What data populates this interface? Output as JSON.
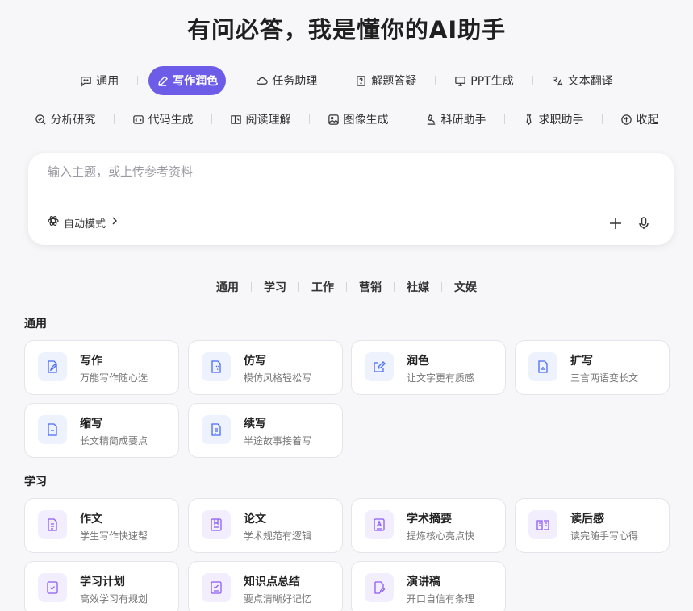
{
  "page_title": "有问必答，我是懂你的AI助手",
  "tabs_row1": [
    {
      "label": "通用",
      "icon": "chat-bubble-icon",
      "active": false
    },
    {
      "label": "写作润色",
      "icon": "pen-icon",
      "active": true
    },
    {
      "label": "任务助理",
      "icon": "cloud-icon",
      "active": false
    },
    {
      "label": "解题答疑",
      "icon": "question-doc-icon",
      "active": false
    },
    {
      "label": "PPT生成",
      "icon": "presentation-icon",
      "active": false
    },
    {
      "label": "文本翻译",
      "icon": "translate-icon",
      "active": false
    }
  ],
  "tabs_row2": [
    {
      "label": "分析研究",
      "icon": "analysis-icon"
    },
    {
      "label": "代码生成",
      "icon": "code-icon"
    },
    {
      "label": "阅读理解",
      "icon": "book-icon"
    },
    {
      "label": "图像生成",
      "icon": "image-icon"
    },
    {
      "label": "科研助手",
      "icon": "microscope-icon"
    },
    {
      "label": "求职助手",
      "icon": "tie-icon"
    },
    {
      "label": "收起",
      "icon": "collapse-up-icon"
    }
  ],
  "input": {
    "placeholder": "输入主题，或上传参考资料",
    "value": ""
  },
  "mode": {
    "label": "自动模式"
  },
  "categories": [
    "通用",
    "学习",
    "工作",
    "营销",
    "社媒",
    "文娱"
  ],
  "sections": [
    {
      "title": "通用",
      "color": "blue",
      "cards": [
        {
          "title": "写作",
          "desc": "万能写作随心选",
          "icon": "write-doc-icon"
        },
        {
          "title": "仿写",
          "desc": "模仿风格轻松写",
          "icon": "copy-doc-icon"
        },
        {
          "title": "润色",
          "desc": "让文字更有质感",
          "icon": "edit-square-icon"
        },
        {
          "title": "扩写",
          "desc": "三言两语变长文",
          "icon": "expand-doc-icon"
        },
        {
          "title": "缩写",
          "desc": "长文精简成要点",
          "icon": "shrink-doc-icon"
        },
        {
          "title": "续写",
          "desc": "半途故事接着写",
          "icon": "continue-doc-icon"
        }
      ]
    },
    {
      "title": "学习",
      "color": "purple",
      "cards": [
        {
          "title": "作文",
          "desc": "学生写作快速帮",
          "icon": "essay-doc-icon"
        },
        {
          "title": "论文",
          "desc": "学术规范有逻辑",
          "icon": "paper-icon"
        },
        {
          "title": "学术摘要",
          "desc": "提炼核心亮点快",
          "icon": "abstract-icon"
        },
        {
          "title": "读后感",
          "desc": "读完随手写心得",
          "icon": "open-book-icon"
        },
        {
          "title": "学习计划",
          "desc": "高效学习有规划",
          "icon": "plan-icon"
        },
        {
          "title": "知识点总结",
          "desc": "要点清晰好记忆",
          "icon": "checklist-icon"
        },
        {
          "title": "演讲稿",
          "desc": "开口自信有条理",
          "icon": "speech-doc-icon"
        }
      ]
    }
  ],
  "colors": {
    "accent": "#6c5ce7",
    "blue_icon": "#4a6cf7",
    "purple_icon": "#8b5cf6"
  }
}
